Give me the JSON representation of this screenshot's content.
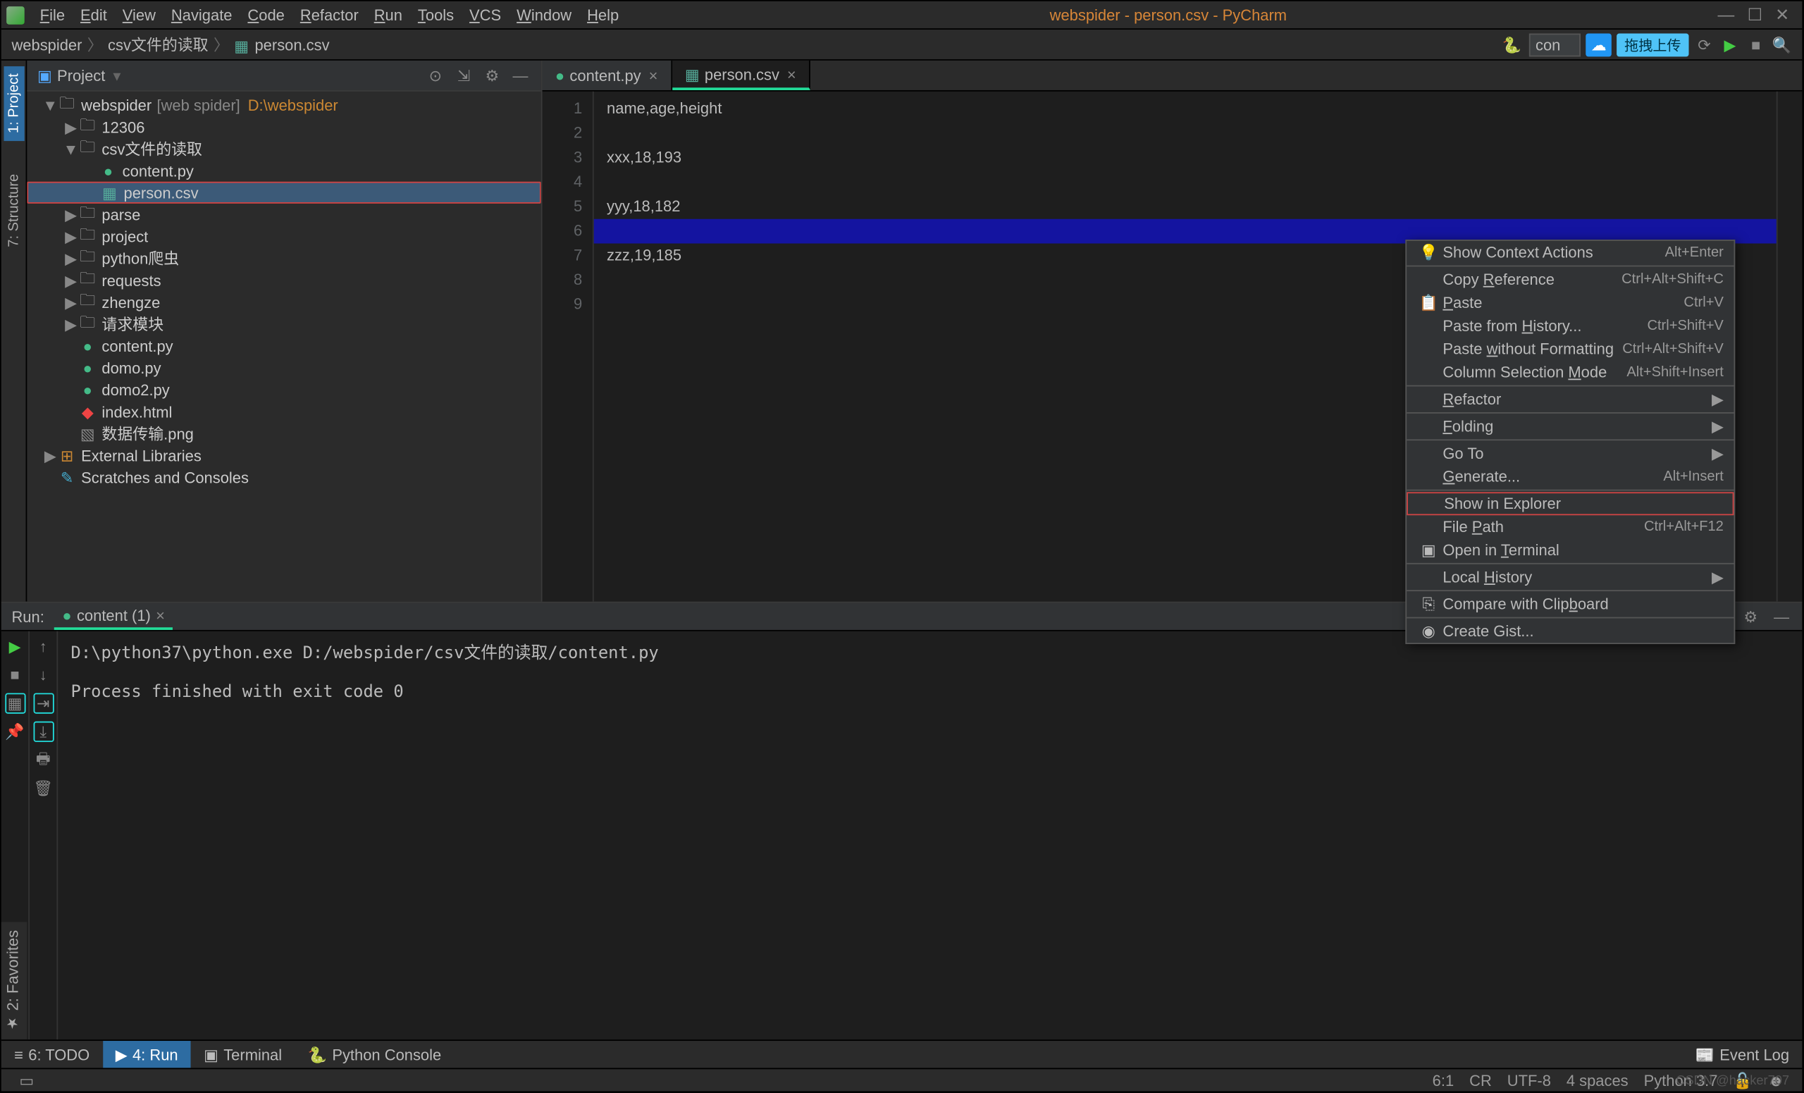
{
  "window": {
    "title": "webspider - person.csv - PyCharm"
  },
  "menubar": [
    "File",
    "Edit",
    "View",
    "Navigate",
    "Code",
    "Refactor",
    "Run",
    "Tools",
    "VCS",
    "Window",
    "Help"
  ],
  "breadcrumbs": [
    "webspider",
    "csv文件的读取",
    "person.csv"
  ],
  "search_text": "con",
  "upload_label": "拖拽上传",
  "project": {
    "title": "Project",
    "root": {
      "name": "webspider",
      "module": "[web spider]",
      "path": "D:\\webspider"
    },
    "tree": [
      {
        "indent": 0,
        "arrow": "▼",
        "icon": "folder",
        "label": "webspider",
        "extra_module": "[web spider]",
        "extra_path": "D:\\webspider"
      },
      {
        "indent": 1,
        "arrow": "▶",
        "icon": "folder",
        "label": "12306"
      },
      {
        "indent": 1,
        "arrow": "▼",
        "icon": "folder",
        "label": "csv文件的读取"
      },
      {
        "indent": 2,
        "arrow": "",
        "icon": "py",
        "label": "content.py"
      },
      {
        "indent": 2,
        "arrow": "",
        "icon": "csv",
        "label": "person.csv",
        "selected": true
      },
      {
        "indent": 1,
        "arrow": "▶",
        "icon": "folder",
        "label": "parse"
      },
      {
        "indent": 1,
        "arrow": "▶",
        "icon": "folder",
        "label": "project"
      },
      {
        "indent": 1,
        "arrow": "▶",
        "icon": "folder",
        "label": "python爬虫"
      },
      {
        "indent": 1,
        "arrow": "▶",
        "icon": "folder",
        "label": "requests"
      },
      {
        "indent": 1,
        "arrow": "▶",
        "icon": "folder",
        "label": "zhengze"
      },
      {
        "indent": 1,
        "arrow": "▶",
        "icon": "folder",
        "label": "请求模块"
      },
      {
        "indent": 1,
        "arrow": "",
        "icon": "py",
        "label": "content.py"
      },
      {
        "indent": 1,
        "arrow": "",
        "icon": "py",
        "label": "domo.py"
      },
      {
        "indent": 1,
        "arrow": "",
        "icon": "py",
        "label": "domo2.py"
      },
      {
        "indent": 1,
        "arrow": "",
        "icon": "html",
        "label": "index.html"
      },
      {
        "indent": 1,
        "arrow": "",
        "icon": "png",
        "label": "数据传输.png"
      },
      {
        "indent": 0,
        "arrow": "▶",
        "icon": "lib",
        "label": "External Libraries"
      },
      {
        "indent": 0,
        "arrow": "",
        "icon": "scratch",
        "label": "Scratches and Consoles"
      }
    ]
  },
  "side_tabs": {
    "project": "1: Project",
    "structure": "7: Structure",
    "favorites": "2: Favorites"
  },
  "editor_tabs": [
    {
      "name": "content.py",
      "icon": "py",
      "active": false
    },
    {
      "name": "person.csv",
      "icon": "csv",
      "active": true
    }
  ],
  "code_lines": [
    "name,age,height",
    "",
    "xxx,18,193",
    "",
    "yyy,18,182",
    "",
    "zzz,19,185",
    "",
    ""
  ],
  "highlight_line": 6,
  "context_menu": [
    {
      "type": "item",
      "icon": "💡",
      "label": "Show Context Actions",
      "shortcut": "Alt+Enter"
    },
    {
      "type": "sep"
    },
    {
      "type": "item",
      "label": "Copy Reference",
      "ul": "R",
      "shortcut": "Ctrl+Alt+Shift+C"
    },
    {
      "type": "item",
      "icon": "📋",
      "label": "Paste",
      "ul": "P",
      "shortcut": "Ctrl+V"
    },
    {
      "type": "item",
      "label": "Paste from History...",
      "ul": "H",
      "shortcut": "Ctrl+Shift+V"
    },
    {
      "type": "item",
      "label": "Paste without Formatting",
      "ul": "w",
      "shortcut": "Ctrl+Alt+Shift+V"
    },
    {
      "type": "item",
      "label": "Column Selection Mode",
      "ul": "M",
      "shortcut": "Alt+Shift+Insert"
    },
    {
      "type": "sep"
    },
    {
      "type": "item",
      "label": "Refactor",
      "ul": "R",
      "sub": true
    },
    {
      "type": "sep"
    },
    {
      "type": "item",
      "label": "Folding",
      "ul": "F",
      "sub": true
    },
    {
      "type": "sep"
    },
    {
      "type": "item",
      "label": "Go To",
      "sub": true
    },
    {
      "type": "item",
      "label": "Generate...",
      "ul": "G",
      "shortcut": "Alt+Insert"
    },
    {
      "type": "sep"
    },
    {
      "type": "item",
      "label": "Show in Explorer",
      "hl": true
    },
    {
      "type": "item",
      "label": "File Path",
      "ul": "P",
      "shortcut": "Ctrl+Alt+F12"
    },
    {
      "type": "item",
      "icon": "▣",
      "label": "Open in Terminal",
      "ul": "T"
    },
    {
      "type": "sep"
    },
    {
      "type": "item",
      "label": "Local History",
      "ul": "H",
      "sub": true
    },
    {
      "type": "sep"
    },
    {
      "type": "item",
      "icon": "⎘",
      "label": "Compare with Clipboard",
      "ul": "b"
    },
    {
      "type": "sep"
    },
    {
      "type": "item",
      "icon": "◉",
      "label": "Create Gist..."
    }
  ],
  "run": {
    "label": "Run:",
    "tab": "content (1)",
    "output": "D:\\python37\\python.exe D:/webspider/csv文件的读取/content.py\n\nProcess finished with exit code 0\n"
  },
  "bottom_tabs": [
    {
      "icon": "≡",
      "label": "6: TODO"
    },
    {
      "icon": "▶",
      "label": "4: Run",
      "active": true
    },
    {
      "icon": "▣",
      "label": "Terminal"
    },
    {
      "icon": "🐍",
      "label": "Python Console"
    }
  ],
  "event_log": "Event Log",
  "status": {
    "pos": "6:1",
    "lineend": "CR",
    "encoding": "UTF-8",
    "indent": "4 spaces",
    "python": "Python 3.7"
  },
  "watermark": "CSDN @hacker707"
}
